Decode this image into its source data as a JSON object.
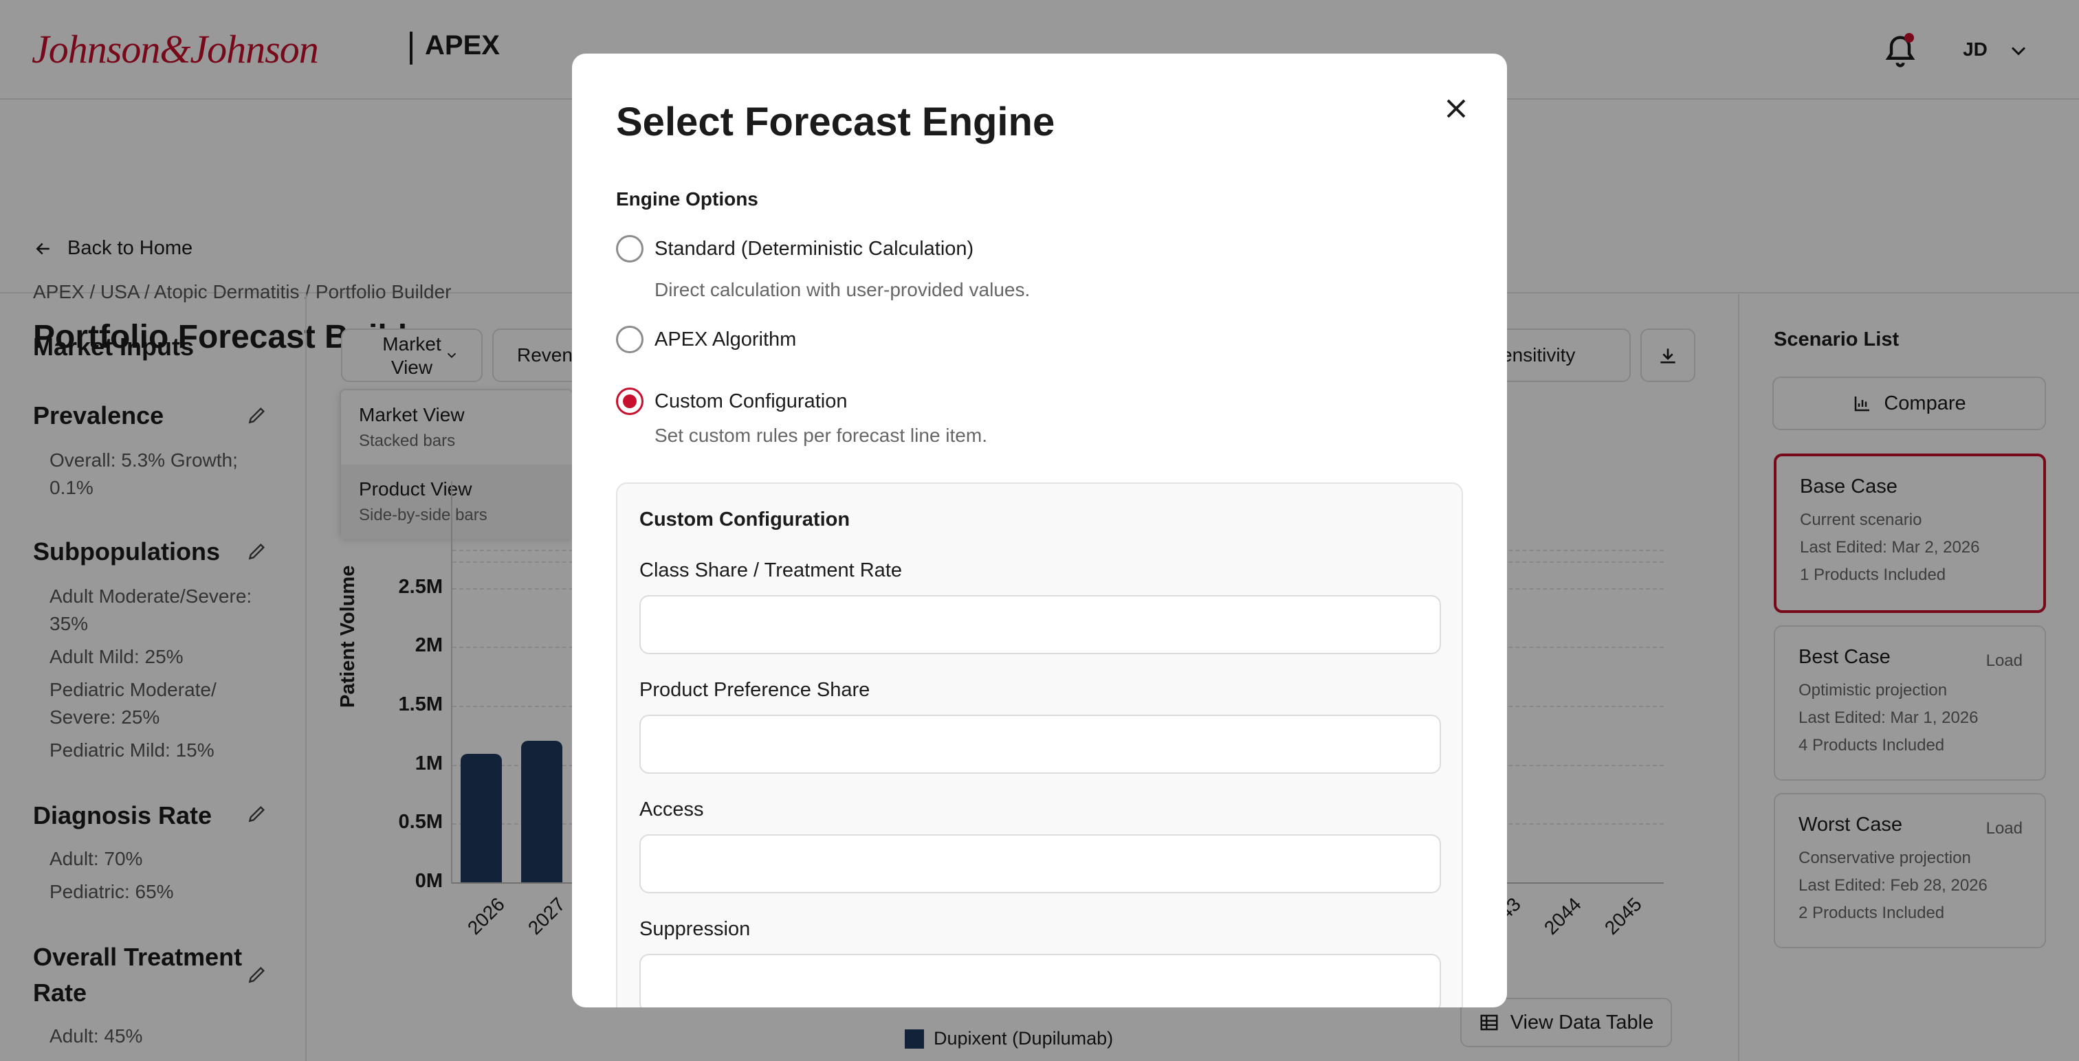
{
  "header": {
    "brand": "Johnson&Johnson",
    "app": "APEX",
    "user_initials": "JD"
  },
  "nav": {
    "back": "Back to Home",
    "breadcrumb": "APEX / USA / Atopic Dermatitis / Portfolio Builder",
    "title": "Portfolio Forecast Builder"
  },
  "market_inputs": {
    "title": "Market Inputs",
    "sections": [
      {
        "title": "Prevalence",
        "lines": [
          "Overall: 5.3% Growth;",
          "0.1%"
        ]
      },
      {
        "title": "Subpopulations",
        "lines": [
          "Adult Moderate/Severe:",
          "35%",
          "Adult Mild: 25%",
          "Pediatric Moderate/",
          "Severe: 25%",
          "Pediatric Mild: 15%"
        ]
      },
      {
        "title": "Diagnosis Rate",
        "lines": [
          "Adult: 70%",
          "Pediatric: 65%"
        ]
      },
      {
        "title": "Overall Treatment",
        "title2": "Rate",
        "lines": [
          "Adult: 45%"
        ]
      }
    ]
  },
  "toolbar": {
    "view_select": "Market View",
    "view_select_l1": "Market",
    "view_select_l2": "View",
    "revenue": "Reven",
    "sensitivity": "n Sensitivity"
  },
  "view_dropdown": [
    {
      "label": "Market View",
      "sub": "Stacked bars"
    },
    {
      "label": "Product View",
      "sub": "Side-by-side bars"
    }
  ],
  "chart_data": {
    "type": "bar",
    "ylabel": "Patient Volume",
    "ylim": [
      0,
      3000000
    ],
    "yticks": [
      "0M",
      "0.5M",
      "1M",
      "1.5M",
      "2M",
      "2.5M"
    ],
    "visible_categories": [
      "2026",
      "2027"
    ],
    "values": [
      1090000,
      1200000
    ],
    "right_ticks": [
      "43",
      "2044",
      "2045"
    ],
    "series": [
      {
        "name": "Dupixent (Dupilumab)"
      }
    ]
  },
  "view_data_table": "View Data Table",
  "scenario_list": {
    "title": "Scenario List",
    "compare": "Compare",
    "items": [
      {
        "name": "Base Case",
        "desc": "Current scenario",
        "edited": "Last Edited: Mar 2, 2026",
        "products": "1 Products Included",
        "action": ""
      },
      {
        "name": "Best Case",
        "desc": "Optimistic projection",
        "edited": "Last Edited: Mar 1, 2026",
        "products": "4 Products Included",
        "action": "Load"
      },
      {
        "name": "Worst Case",
        "desc": "Conservative projection",
        "edited": "Last Edited: Feb 28, 2026",
        "products": "2 Products Included",
        "action": "Load"
      }
    ]
  },
  "modal": {
    "title": "Select Forecast Engine",
    "section": "Engine Options",
    "options": [
      {
        "label": "Standard (Deterministic Calculation)",
        "desc": "Direct calculation with user-provided values.",
        "selected": false
      },
      {
        "label": "APEX Algorithm",
        "desc": "",
        "selected": false
      },
      {
        "label": "Custom Configuration",
        "desc": "Set custom rules per forecast line item.",
        "selected": true
      }
    ],
    "custom": {
      "title": "Custom Configuration",
      "fields": [
        {
          "label": "Class Share / Treatment Rate",
          "value": ""
        },
        {
          "label": "Product Preference Share",
          "value": ""
        },
        {
          "label": "Access",
          "value": ""
        },
        {
          "label": "Suppression",
          "value": ""
        }
      ]
    }
  },
  "colors": {
    "accent": "#c8102e",
    "bar": "#1f3a5f"
  }
}
